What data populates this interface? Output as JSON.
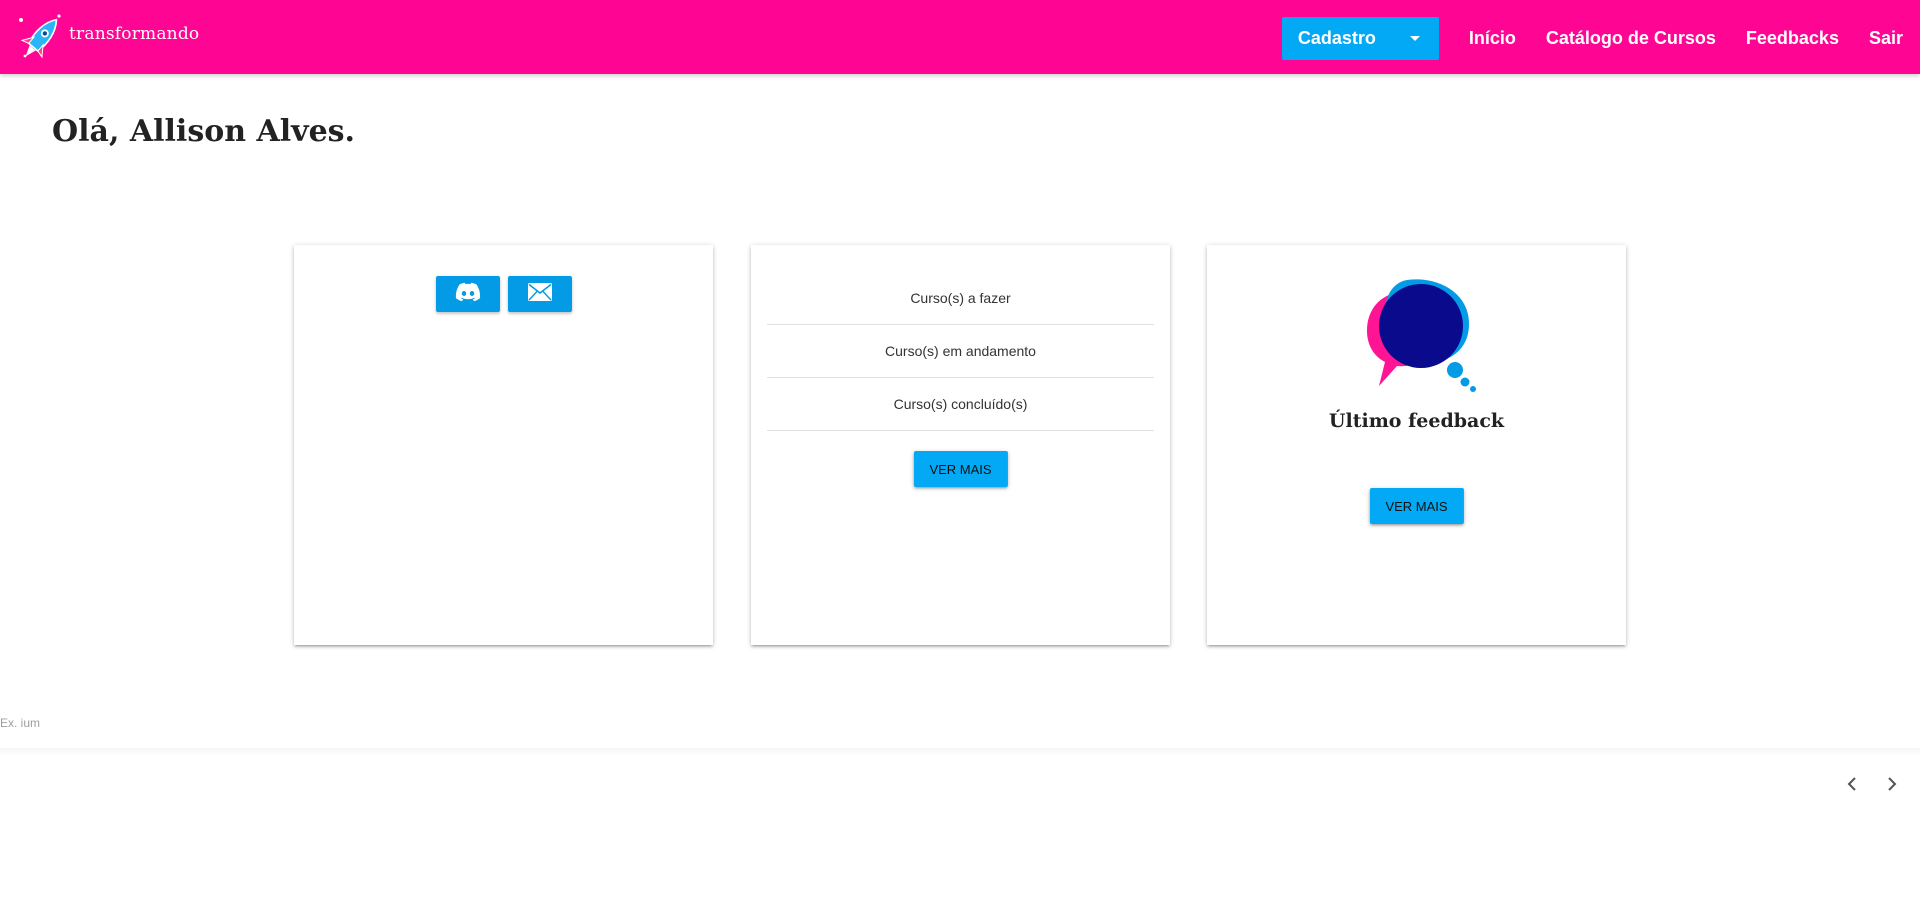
{
  "brand": {
    "name": "transformando",
    "logo_icon": "rocket-icon"
  },
  "nav": {
    "dropdown_label": "Cadastro",
    "links": [
      "Início",
      "Catálogo de Cursos",
      "Feedbacks",
      "Sair"
    ]
  },
  "greeting": "Olá, Allison Alves.",
  "social": {
    "icons": [
      "discord-icon",
      "mail-icon"
    ]
  },
  "courses": {
    "items": [
      "Curso(s) a fazer",
      "Curso(s) em andamento",
      "Curso(s) concluído(s)"
    ],
    "button": "VER MAIS"
  },
  "feedback": {
    "icon": "speech-bubbles-icon",
    "title": "Último feedback",
    "button": "VER MAIS"
  },
  "footer": {
    "hint": "Ex. ium",
    "prev_icon": "chevron-left-icon",
    "next_icon": "chevron-right-icon"
  },
  "colors": {
    "navbar": "#ff0593",
    "accent": "#03a9f4",
    "bubble_pink": "#ff1493",
    "bubble_blue": "#039be5",
    "bubble_navy": "#0a0a8c"
  }
}
